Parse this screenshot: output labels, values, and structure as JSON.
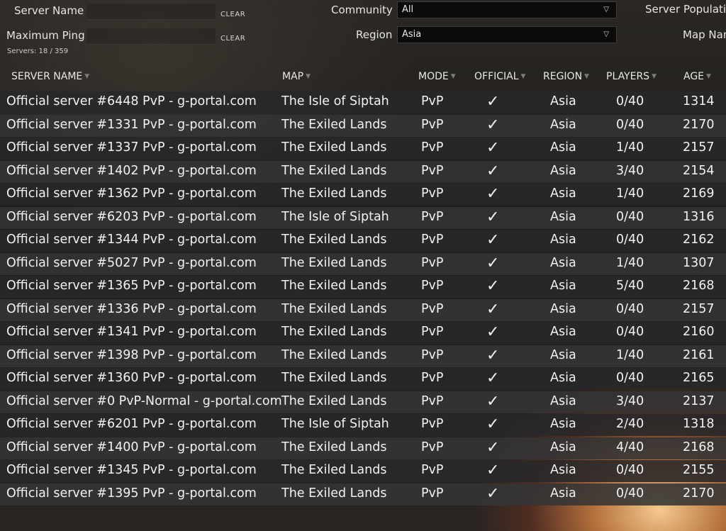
{
  "filters": {
    "server_name_label": "Server Name",
    "server_name_value": "",
    "max_ping_label": "Maximum Ping",
    "max_ping_value": "",
    "clear_label": "CLEAR",
    "servers_count": "Servers: 18 / 359",
    "community_label": "Community",
    "community_value": "All",
    "region_label": "Region",
    "region_value": "Asia",
    "population_label": "Server Populatio",
    "map_name_label": "Map Nam"
  },
  "columns": {
    "server_name": "SERVER NAME",
    "map": "MAP",
    "mode": "MODE",
    "official": "OFFICIAL",
    "region": "REGION",
    "players": "PLAYERS",
    "age": "AGE"
  },
  "icons": {
    "dropdown": "chevron-down-icon",
    "sort": "sort-arrow-icon",
    "official": "checkmark-icon"
  },
  "servers": [
    {
      "name": "Official server #6448 PvP - g-portal.com",
      "map": "The Isle of Siptah",
      "mode": "PvP",
      "official": "✓",
      "region": "Asia",
      "players": "0/40",
      "age": "1314"
    },
    {
      "name": "Official server #1331 PvP - g-portal.com",
      "map": "The Exiled Lands",
      "mode": "PvP",
      "official": "✓",
      "region": "Asia",
      "players": "0/40",
      "age": "2170"
    },
    {
      "name": "Official server #1337 PvP - g-portal.com",
      "map": "The Exiled Lands",
      "mode": "PvP",
      "official": "✓",
      "region": "Asia",
      "players": "1/40",
      "age": "2157"
    },
    {
      "name": "Official server #1402 PvP - g-portal.com",
      "map": "The Exiled Lands",
      "mode": "PvP",
      "official": "✓",
      "region": "Asia",
      "players": "3/40",
      "age": "2154"
    },
    {
      "name": "Official server #1362 PvP - g-portal.com",
      "map": "The Exiled Lands",
      "mode": "PvP",
      "official": "✓",
      "region": "Asia",
      "players": "1/40",
      "age": "2169"
    },
    {
      "name": "Official server #6203 PvP - g-portal.com",
      "map": "The Isle of Siptah",
      "mode": "PvP",
      "official": "✓",
      "region": "Asia",
      "players": "0/40",
      "age": "1316"
    },
    {
      "name": "Official server #1344 PvP - g-portal.com",
      "map": "The Exiled Lands",
      "mode": "PvP",
      "official": "✓",
      "region": "Asia",
      "players": "0/40",
      "age": "2162"
    },
    {
      "name": "Official server #5027 PvP - g-portal.com",
      "map": "The Exiled Lands",
      "mode": "PvP",
      "official": "✓",
      "region": "Asia",
      "players": "1/40",
      "age": "1307"
    },
    {
      "name": "Official server #1365 PvP - g-portal.com",
      "map": "The Exiled Lands",
      "mode": "PvP",
      "official": "✓",
      "region": "Asia",
      "players": "5/40",
      "age": "2168"
    },
    {
      "name": "Official server #1336 PvP - g-portal.com",
      "map": "The Exiled Lands",
      "mode": "PvP",
      "official": "✓",
      "region": "Asia",
      "players": "0/40",
      "age": "2157"
    },
    {
      "name": "Official server #1341 PvP - g-portal.com",
      "map": "The Exiled Lands",
      "mode": "PvP",
      "official": "✓",
      "region": "Asia",
      "players": "0/40",
      "age": "2160"
    },
    {
      "name": "Official server #1398 PvP - g-portal.com",
      "map": "The Exiled Lands",
      "mode": "PvP",
      "official": "✓",
      "region": "Asia",
      "players": "1/40",
      "age": "2161"
    },
    {
      "name": "Official server #1360 PvP - g-portal.com",
      "map": "The Exiled Lands",
      "mode": "PvP",
      "official": "✓",
      "region": "Asia",
      "players": "0/40",
      "age": "2165"
    },
    {
      "name": "Official server #0 PvP-Normal - g-portal.com",
      "map": "The Exiled Lands",
      "mode": "PvP",
      "official": "✓",
      "region": "Asia",
      "players": "3/40",
      "age": "2137"
    },
    {
      "name": "Official server #6201 PvP - g-portal.com",
      "map": "The Isle of Siptah",
      "mode": "PvP",
      "official": "✓",
      "region": "Asia",
      "players": "2/40",
      "age": "1318"
    },
    {
      "name": "Official server #1400 PvP - g-portal.com",
      "map": "The Exiled Lands",
      "mode": "PvP",
      "official": "✓",
      "region": "Asia",
      "players": "4/40",
      "age": "2168"
    },
    {
      "name": "Official server #1345 PvP - g-portal.com",
      "map": "The Exiled Lands",
      "mode": "PvP",
      "official": "✓",
      "region": "Asia",
      "players": "0/40",
      "age": "2155"
    },
    {
      "name": "Official server #1395 PvP - g-portal.com",
      "map": "The Exiled Lands",
      "mode": "PvP",
      "official": "✓",
      "region": "Asia",
      "players": "0/40",
      "age": "2170"
    }
  ]
}
